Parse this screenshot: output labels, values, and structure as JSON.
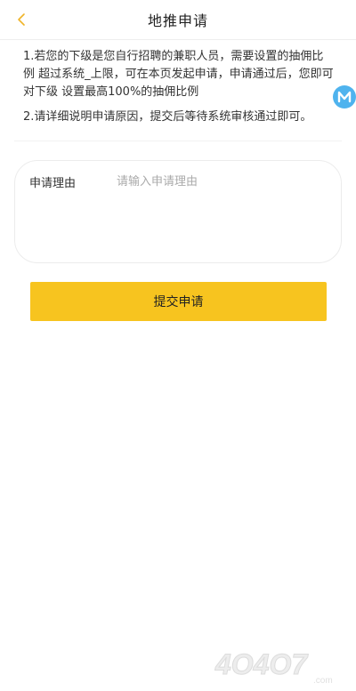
{
  "header": {
    "title": "地推申请",
    "back_icon": "chevron-left-icon"
  },
  "notes": {
    "item1": "1.若您的下级是您自行招聘的兼职人员，需要设置的抽佣比例 超过系统_上限，可在本页发起申请，申请通过后，您即可对下级 设置最高100%的抽佣比例",
    "item2": "2.请详细说明申请原因，提交后等待系统审核通过即可。"
  },
  "float_badge": {
    "letter": "M"
  },
  "form": {
    "reason_label": "申请理由",
    "reason_value": "",
    "reason_placeholder": "请输入申请理由"
  },
  "submit": {
    "label": "提交申请"
  },
  "watermark": {
    "text": "4O4O7",
    "suffix": ".com"
  },
  "colors": {
    "accent": "#f7c41f",
    "back_arrow": "#f0b429",
    "badge": "#4fb3ee"
  }
}
